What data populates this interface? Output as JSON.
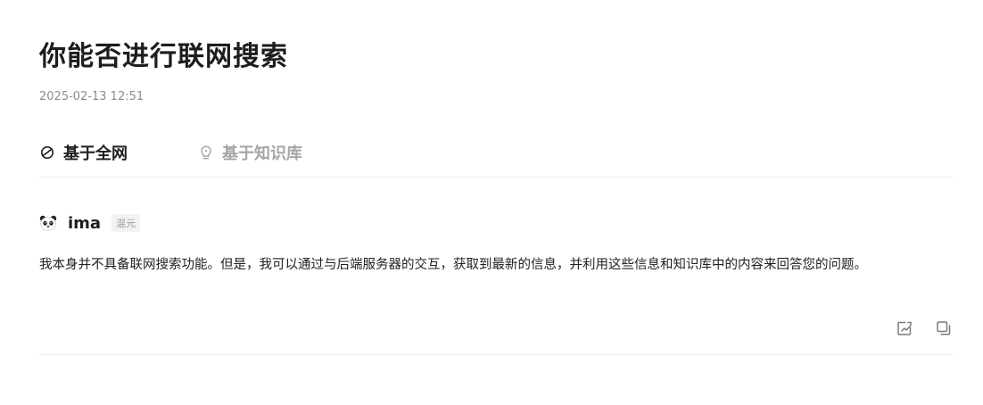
{
  "question": {
    "title": "你能否进行联网搜索",
    "timestamp": "2025-02-13 12:51"
  },
  "tabs": [
    {
      "label": "基于全网",
      "icon": "globe-search-icon",
      "active": true
    },
    {
      "label": "基于知识库",
      "icon": "lightbulb-icon",
      "active": false
    }
  ],
  "answer": {
    "author": "ima",
    "avatar": "panda-avatar",
    "model": "混元",
    "text": "我本身并不具备联网搜索功能。但是，我可以通过与后端服务器的交互，获取到最新的信息，并利用这些信息和知识库中的内容来回答您的问题。",
    "actions": [
      {
        "icon": "edit-note-icon"
      },
      {
        "icon": "copy-icon"
      }
    ]
  },
  "colors": {
    "text_primary": "#1f1f1f",
    "text_muted": "#8c8c8c",
    "tab_inactive": "#a6a6a6",
    "divider": "#ececec",
    "badge_bg": "#f2f2f2"
  }
}
